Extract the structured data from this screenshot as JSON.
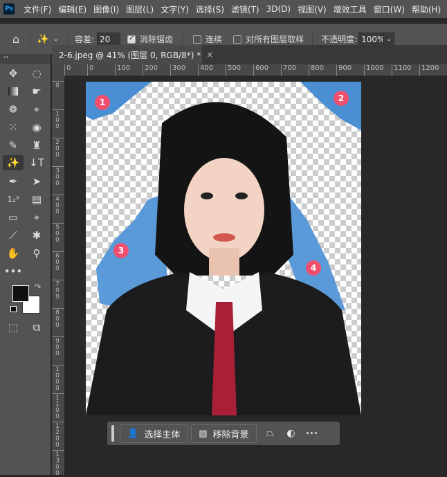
{
  "menubar": {
    "logo": "Ps",
    "items": [
      "文件(F)",
      "编辑(E)",
      "图像(I)",
      "图层(L)",
      "文字(Y)",
      "选择(S)",
      "滤镜(T)",
      "3D(D)",
      "视图(V)",
      "增效工具",
      "窗口(W)",
      "帮助(H)"
    ]
  },
  "options": {
    "tolerance_label": "容差:",
    "tolerance_value": "20",
    "antialias_label": "消除锯齿",
    "contiguous_label": "连续",
    "sample_all_label": "对所有图层取样",
    "opacity_label": "不透明度:",
    "opacity_value": "100%"
  },
  "toolbar": {
    "collapse": "‹‹"
  },
  "tab": {
    "title": "2-6.jpeg @ 41% (图层 0, RGB/8*) *",
    "close": "×"
  },
  "ruler": {
    "h": [
      "0",
      "0",
      "100",
      "200",
      "300",
      "400",
      "500",
      "600",
      "700",
      "800",
      "900",
      "1000",
      "1100",
      "1200"
    ],
    "v": [
      "0",
      "100",
      "200",
      "300",
      "400",
      "500",
      "600",
      "700",
      "800",
      "900",
      "1000",
      "1100",
      "1200",
      "1300"
    ]
  },
  "markers": [
    "1",
    "2",
    "3",
    "4"
  ],
  "taskbar": {
    "select_subject": "选择主体",
    "remove_bg": "移除背景",
    "more": "•••"
  },
  "colors": {
    "accent": "#f0506e",
    "bg_blue": "#4a8fd4"
  }
}
